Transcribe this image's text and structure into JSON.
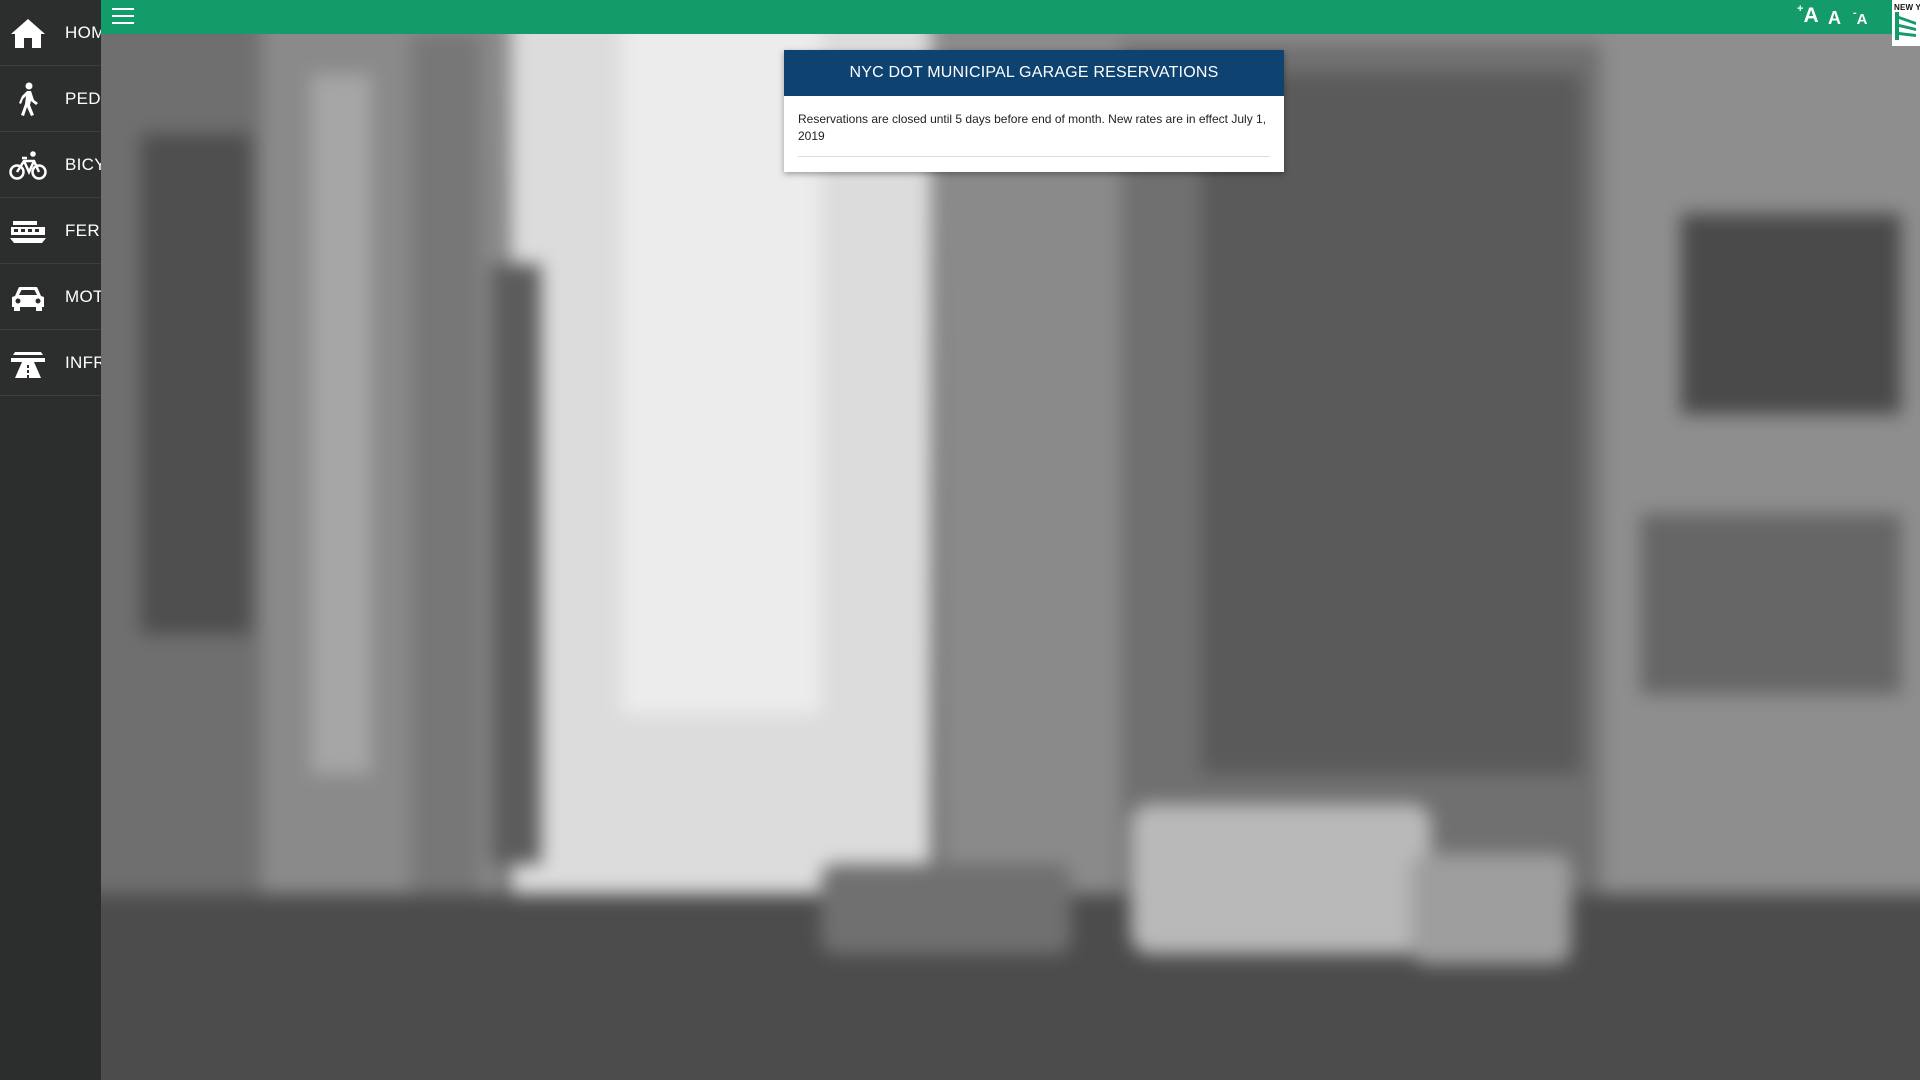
{
  "sidebar": {
    "items": [
      {
        "label": "HOM",
        "icon": "home-icon"
      },
      {
        "label": "PEDE",
        "icon": "pedestrian-icon"
      },
      {
        "label": "BICY",
        "icon": "bicycle-icon"
      },
      {
        "label": "FERR",
        "icon": "ferry-icon"
      },
      {
        "label": "MOT",
        "icon": "car-icon"
      },
      {
        "label": "INFR",
        "icon": "road-icon"
      }
    ]
  },
  "topbar": {
    "menu_icon": "hamburger-menu-icon",
    "font_increase_label": "A",
    "font_increase_sign": "+",
    "font_default_label": "A",
    "font_decrease_label": "A",
    "font_decrease_sign": "-",
    "logo_text": "NEW Y",
    "color": "#149b6a"
  },
  "dialog": {
    "title": "NYC DOT MUNICIPAL GARAGE RESERVATIONS",
    "message": "Reservations are closed until 5 days before end of month. New rates are in effect July 1, 2019",
    "header_color": "#0e4270"
  }
}
